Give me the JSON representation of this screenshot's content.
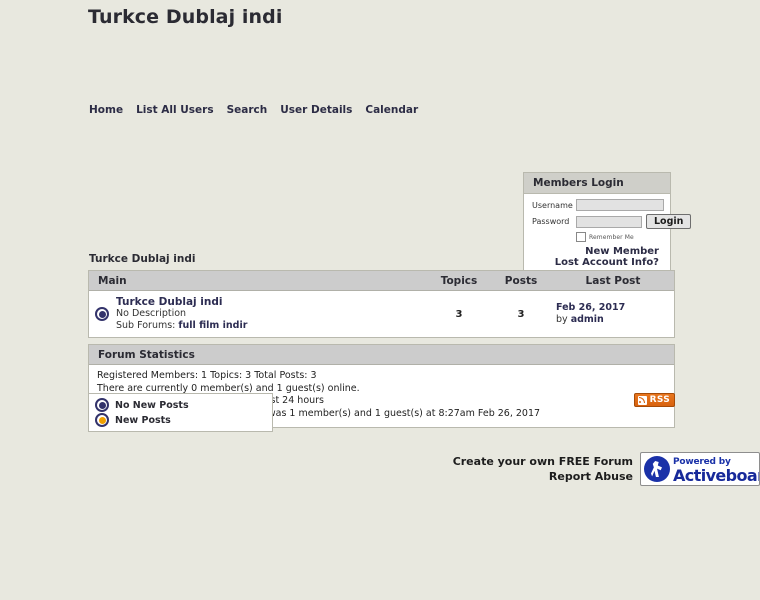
{
  "site": {
    "title": "Turkce Dublaj indi"
  },
  "nav": {
    "items": [
      {
        "label": "Home",
        "name": "nav-home"
      },
      {
        "label": "List All Users",
        "name": "nav-list-all-users"
      },
      {
        "label": "Search",
        "name": "nav-search"
      },
      {
        "label": "User Details",
        "name": "nav-user-details"
      },
      {
        "label": "Calendar",
        "name": "nav-calendar"
      }
    ]
  },
  "login": {
    "header": "Members Login",
    "username_label": "Username",
    "password_label": "Password",
    "username_value": "",
    "password_value": "",
    "remember_label": "Remember Me",
    "login_button": "Login",
    "new_member_link": "New Member",
    "lost_account_link": "Lost Account Info?"
  },
  "breadcrumb": {
    "text": "Turkce Dublaj indi"
  },
  "forum_table": {
    "header": {
      "main": "Main",
      "topics": "Topics",
      "posts": "Posts",
      "last_post": "Last Post"
    },
    "rows": [
      {
        "icon": "no-new-posts-icon",
        "title": "Turkce Dublaj indi",
        "description": "No Description",
        "sub_forums_label": "Sub Forums:",
        "sub_forums": "full film indir",
        "topics": "3",
        "posts": "3",
        "last_post_date": "Feb 26, 2017",
        "last_post_by_prefix": "by",
        "last_post_author": "admin"
      }
    ]
  },
  "statistics": {
    "header": "Forum Statistics",
    "lines": [
      "Registered Members: 1   Topics: 3   Total Posts: 3",
      "There are currently 0 member(s) and 1 guest(s) online.",
      "1 user(s) visited this forum in the past 24 hours",
      "The most users ever online at once was 1 member(s) and 1 guest(s) at 8:27am Feb 26, 2017"
    ]
  },
  "legend": {
    "items": [
      {
        "label": "No New Posts",
        "icon": "no-new-posts-icon"
      },
      {
        "label": "New Posts",
        "icon": "new-posts-icon"
      }
    ]
  },
  "rss": {
    "label": "RSS",
    "icon": "rss-icon"
  },
  "footer": {
    "create_forum_link": "Create your own FREE Forum",
    "report_abuse_link": "Report Abuse",
    "logo_powered_by": "Powered by",
    "logo_name": "Activeboard"
  },
  "colors": {
    "page_background": "#e8e8df",
    "panel_header": "#cccccc",
    "panel_background": "#ffffff",
    "link": "#2c2c52",
    "rss_orange": "#d8620f",
    "logo_blue": "#17299a"
  }
}
